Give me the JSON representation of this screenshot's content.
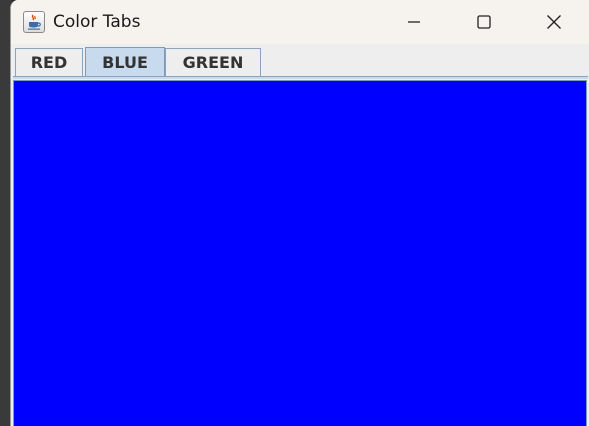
{
  "window": {
    "title": "Color Tabs",
    "controls": {
      "minimize": "minimize-icon",
      "maximize": "maximize-icon",
      "close": "close-icon"
    }
  },
  "tabs": [
    {
      "label": "RED",
      "selected": false
    },
    {
      "label": "BLUE",
      "selected": true
    },
    {
      "label": "GREEN",
      "selected": false
    }
  ],
  "panel": {
    "color": "#0000ff"
  },
  "colors": {
    "selected_tab": "#c8daee",
    "panel": "#0000ff"
  }
}
